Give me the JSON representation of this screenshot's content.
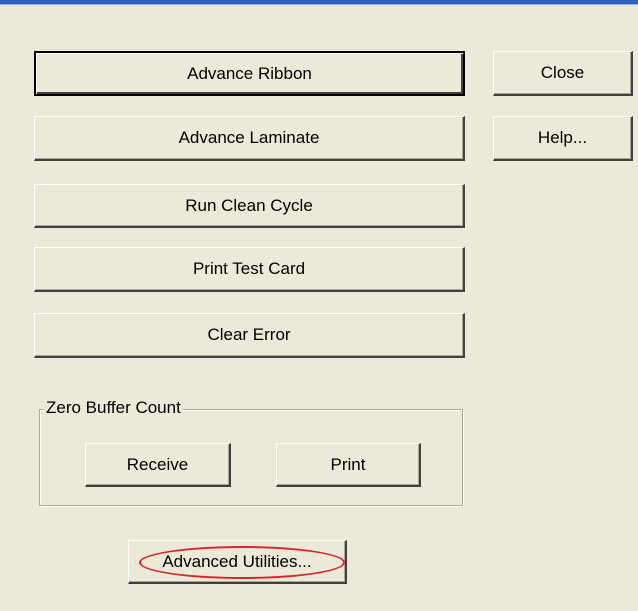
{
  "buttons": {
    "advance_ribbon": "Advance Ribbon",
    "advance_laminate": "Advance Laminate",
    "run_clean_cycle": "Run Clean Cycle",
    "print_test_card": "Print Test Card",
    "clear_error": "Clear Error",
    "close": "Close",
    "help": "Help...",
    "advanced_utilities": "Advanced Utilities..."
  },
  "zero_buffer_count": {
    "legend": "Zero Buffer Count",
    "receive": "Receive",
    "print": "Print"
  },
  "colors": {
    "window_bg": "#ece9d8",
    "title_bar": "#2d5fc4",
    "highlight_ellipse": "#d8262e"
  }
}
